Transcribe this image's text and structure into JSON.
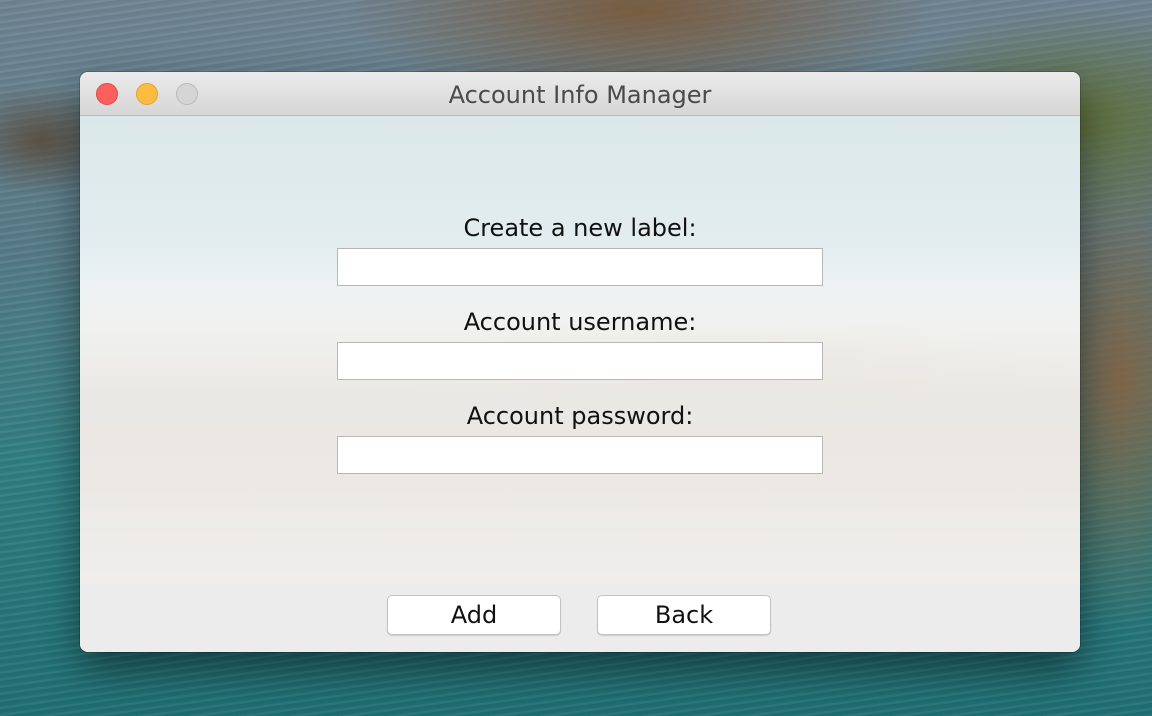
{
  "window": {
    "title": "Account Info Manager"
  },
  "form": {
    "label_field": {
      "label": "Create a new label:",
      "value": ""
    },
    "username_field": {
      "label": "Account username:",
      "value": ""
    },
    "password_field": {
      "label": "Account password:",
      "value": ""
    }
  },
  "buttons": {
    "add_label": "Add",
    "back_label": "Back"
  },
  "colors": {
    "close_button": "#fc605c",
    "minimize_button": "#fdbc40",
    "zoom_button": "#d5d5d5"
  }
}
